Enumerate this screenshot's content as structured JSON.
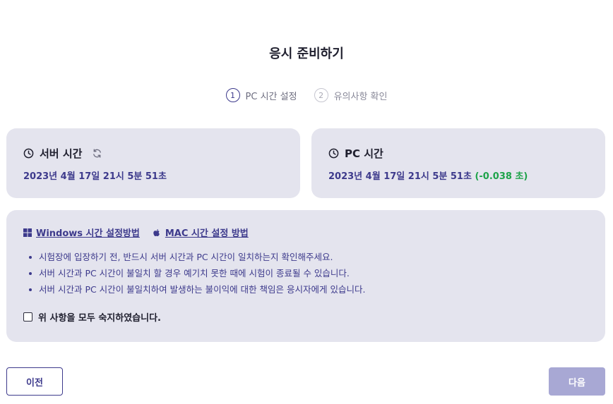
{
  "page": {
    "title": "응시 준비하기"
  },
  "steps": [
    {
      "number": "1",
      "label": "PC 시간 설정",
      "state": "active"
    },
    {
      "number": "2",
      "label": "유의사항 확인",
      "state": "inactive"
    }
  ],
  "server_card": {
    "heading": "서버 시간",
    "time": "2023년 4월 17일 21시 5분 51초",
    "icons": [
      "clock-icon",
      "refresh-icon"
    ]
  },
  "pc_card": {
    "heading": "PC 시간",
    "time": "2023년 4월 17일 21시 5분 51초",
    "diff": "(-0.038 초)",
    "icons": [
      "clock-icon"
    ]
  },
  "guide_links": {
    "windows": "Windows 시간 설정방법",
    "mac": "MAC 시간 설정 방법"
  },
  "notes": [
    "시험장에 입장하기 전, 반드시 서버 시간과 PC 시간이 일치하는지 확인해주세요.",
    "서버 시간과 PC 시간이 불일치 할 경우 예기치 못한 때에 시험이 종료될 수 있습니다.",
    "서버 시간과 PC 시간이 불일치하여 발생하는 불이익에 대한 책임은 응시자에게 있습니다."
  ],
  "agreement": {
    "label": "위 사항을 모두 숙지하였습니다.",
    "checked": false
  },
  "buttons": {
    "prev": "이전",
    "next": "다음"
  },
  "colors": {
    "primary": "#3d3a8c",
    "card_bg": "#e4e4ee",
    "diff_green": "#1ea34a",
    "next_disabled": "#a8a8d4"
  }
}
